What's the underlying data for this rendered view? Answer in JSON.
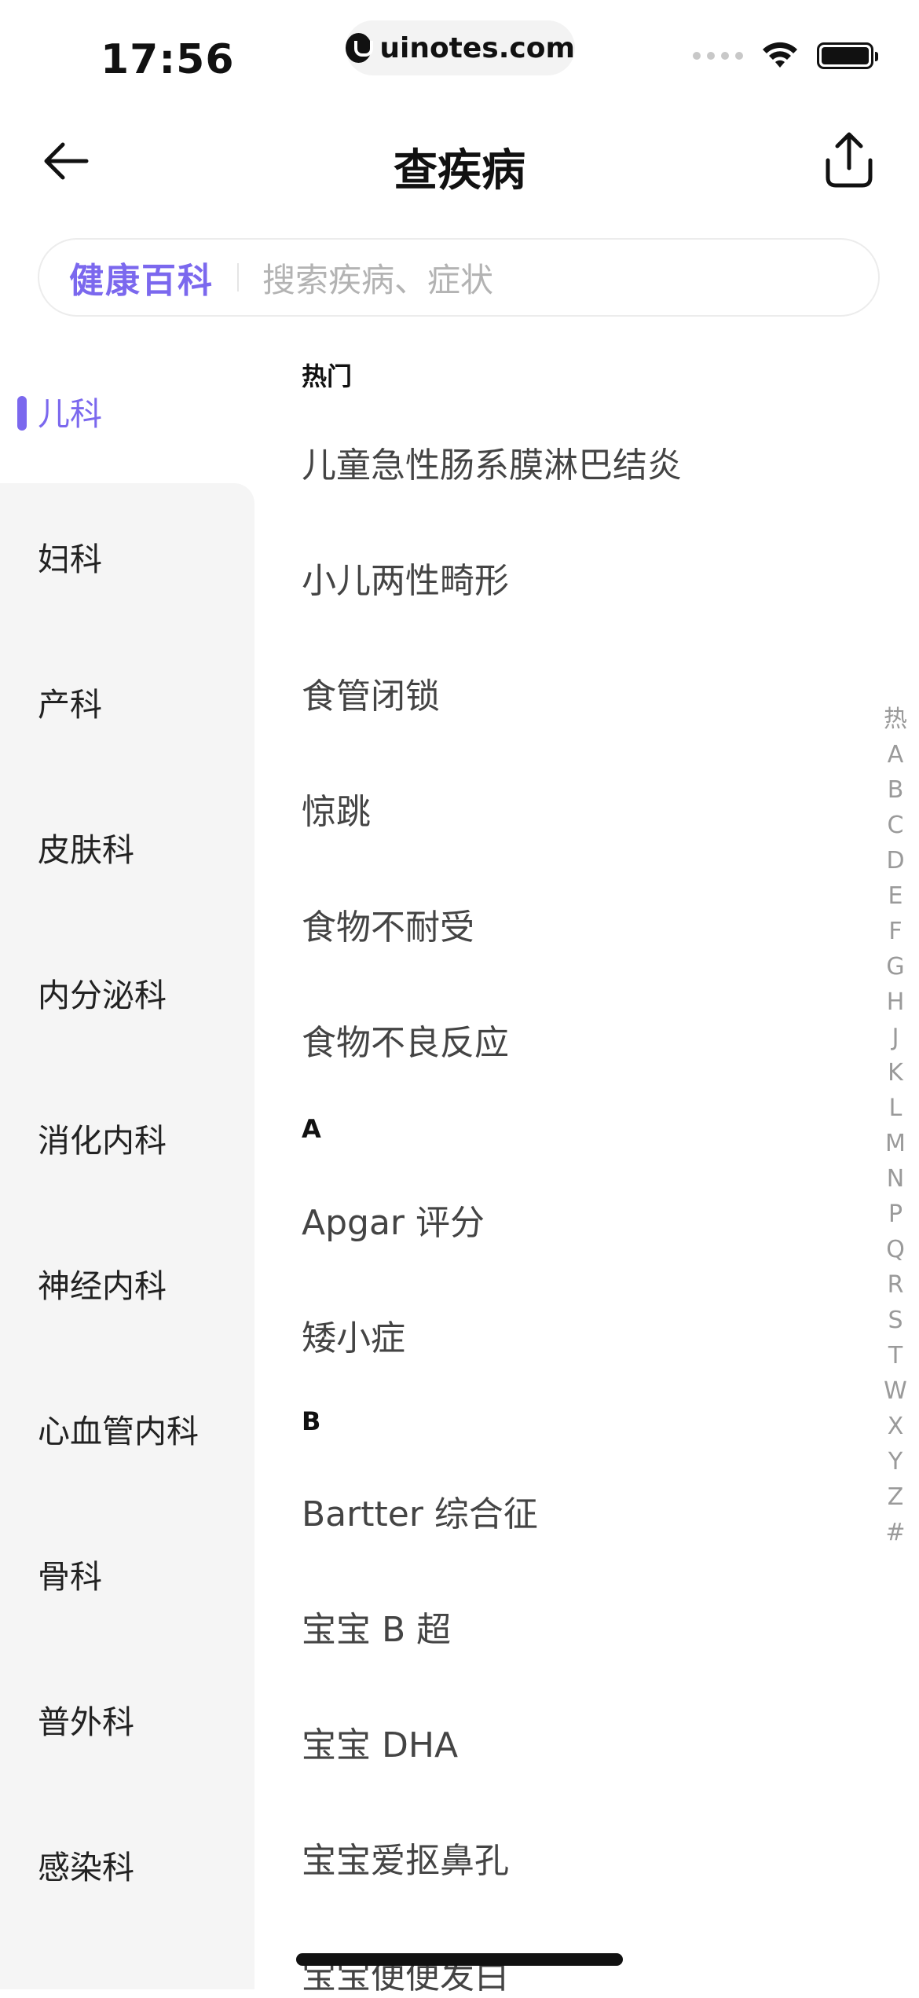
{
  "status_bar": {
    "time": "17:56",
    "url": "uinotes.com",
    "icons": [
      "signal-dots-icon",
      "wifi-icon",
      "battery-icon"
    ]
  },
  "nav": {
    "title": "查疾病",
    "back_icon": "arrow-left-icon",
    "share_icon": "share-icon"
  },
  "search": {
    "brand": "健康百科",
    "placeholder": "搜索疾病、症状"
  },
  "accent_color": "#7b68ee",
  "sidebar": {
    "items": [
      "儿科",
      "妇科",
      "产科",
      "皮肤科",
      "内分泌科",
      "消化内科",
      "神经内科",
      "心血管内科",
      "骨科",
      "普外科",
      "感染科"
    ],
    "active_index": 0
  },
  "sections": [
    {
      "header": "热门",
      "items": [
        "儿童急性肠系膜淋巴结炎",
        "小儿两性畸形",
        "食管闭锁",
        "惊跳",
        "食物不耐受",
        "食物不良反应"
      ]
    },
    {
      "header": "A",
      "items": [
        "Apgar 评分",
        "矮小症"
      ]
    },
    {
      "header": "B",
      "items": [
        "Bartter 综合征",
        "宝宝 B 超",
        "宝宝 DHA",
        "宝宝爱抠鼻孔",
        "宝宝便便发白"
      ]
    }
  ],
  "index_bar": [
    "热",
    "A",
    "B",
    "C",
    "D",
    "E",
    "F",
    "G",
    "H",
    "J",
    "K",
    "L",
    "M",
    "N",
    "P",
    "Q",
    "R",
    "S",
    "T",
    "W",
    "X",
    "Y",
    "Z",
    "#"
  ]
}
